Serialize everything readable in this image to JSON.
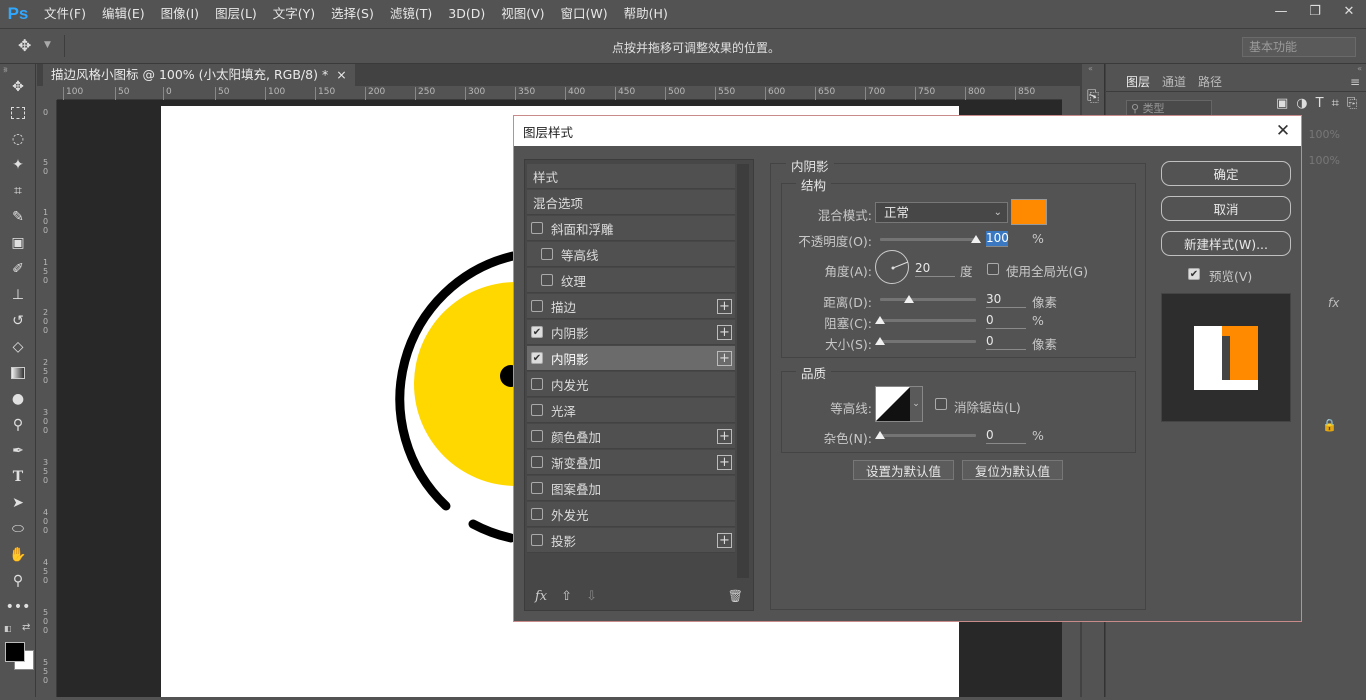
{
  "app": {
    "logo": "Ps"
  },
  "menu": [
    "文件(F)",
    "编辑(E)",
    "图像(I)",
    "图层(L)",
    "文字(Y)",
    "选择(S)",
    "滤镜(T)",
    "3D(D)",
    "视图(V)",
    "窗口(W)",
    "帮助(H)"
  ],
  "window_controls": {
    "minimize": "—",
    "restore": "❐",
    "close": "✕"
  },
  "options_bar": {
    "hint": "点按并拖移可调整效果的位置。",
    "workspace": "基本功能"
  },
  "document": {
    "tab_title": "描边风格小图标 @ 100% (小太阳填充, RGB/8) *",
    "tab_close": "×"
  },
  "ruler_h_labels": [
    "100",
    "50",
    "0",
    "50",
    "100",
    "150",
    "200",
    "250",
    "300",
    "350",
    "400",
    "450",
    "500",
    "550",
    "600",
    "650",
    "700",
    "750",
    "800",
    "850"
  ],
  "ruler_v_labels": [
    "0",
    "5 0",
    "1 0 0",
    "1 5 0",
    "2 0 0",
    "2 5 0",
    "3 0 0",
    "3 5 0",
    "4 0 0",
    "4 5 0",
    "5 0 0",
    "5 5 0"
  ],
  "layers_panel": {
    "tabs": [
      "图层",
      "通道",
      "路径"
    ],
    "search_placeholder": "类型",
    "opacity": "100%",
    "fill": "100%",
    "fx_badge": "fx"
  },
  "dialog": {
    "title": "图层样式",
    "close_label": "✕",
    "style_list": [
      {
        "label": "样式",
        "type": "header"
      },
      {
        "label": "混合选项",
        "type": "header"
      },
      {
        "label": "斜面和浮雕",
        "checked": false,
        "plus": false,
        "indent": 0
      },
      {
        "label": "等高线",
        "checked": false,
        "plus": false,
        "indent": 1
      },
      {
        "label": "纹理",
        "checked": false,
        "plus": false,
        "indent": 1
      },
      {
        "label": "描边",
        "checked": false,
        "plus": true,
        "indent": 0
      },
      {
        "label": "内阴影",
        "checked": true,
        "plus": true,
        "indent": 0
      },
      {
        "label": "内阴影",
        "checked": true,
        "plus": true,
        "indent": 0,
        "selected": true
      },
      {
        "label": "内发光",
        "checked": false,
        "plus": false,
        "indent": 0
      },
      {
        "label": "光泽",
        "checked": false,
        "plus": false,
        "indent": 0
      },
      {
        "label": "颜色叠加",
        "checked": false,
        "plus": true,
        "indent": 0
      },
      {
        "label": "渐变叠加",
        "checked": false,
        "plus": true,
        "indent": 0
      },
      {
        "label": "图案叠加",
        "checked": false,
        "plus": false,
        "indent": 0
      },
      {
        "label": "外发光",
        "checked": false,
        "plus": false,
        "indent": 0
      },
      {
        "label": "投影",
        "checked": false,
        "plus": true,
        "indent": 0
      }
    ],
    "list_footer": {
      "fx": "fx",
      "up": "⇧",
      "down": "⇩",
      "trash": "🗑"
    },
    "panel_title": "内阴影",
    "structure": {
      "title": "结构",
      "blend_mode_label": "混合模式:",
      "blend_mode_value": "正常",
      "color": "#ff8a00",
      "opacity_label": "不透明度(O):",
      "opacity_value": "100",
      "opacity_level": 1.0,
      "opacity_unit": "%",
      "angle_label": "角度(A):",
      "angle_value": "20",
      "angle_unit": "度",
      "global_light_label": "使用全局光(G)",
      "global_light_checked": false,
      "distance_label": "距离(D):",
      "distance_value": "30",
      "distance_level": 0.3,
      "distance_unit": "像素",
      "choke_label": "阻塞(C):",
      "choke_value": "0",
      "choke_level": 0,
      "choke_unit": "%",
      "size_label": "大小(S):",
      "size_value": "0",
      "size_level": 0,
      "size_unit": "像素"
    },
    "quality": {
      "title": "品质",
      "contour_label": "等高线:",
      "antialias_label": "消除锯齿(L)",
      "antialias_checked": false,
      "noise_label": "杂色(N):",
      "noise_value": "0",
      "noise_level": 0,
      "noise_unit": "%"
    },
    "set_default": "设置为默认值",
    "reset_default": "复位为默认值",
    "ok": "确定",
    "cancel": "取消",
    "new_style": "新建样式(W)...",
    "preview_label": "预览(V)",
    "preview_checked": true
  },
  "colors": {
    "accent": "#31a8ff",
    "sun_yellow": "#ffd800",
    "shadow_orange": "#ff8a00"
  }
}
